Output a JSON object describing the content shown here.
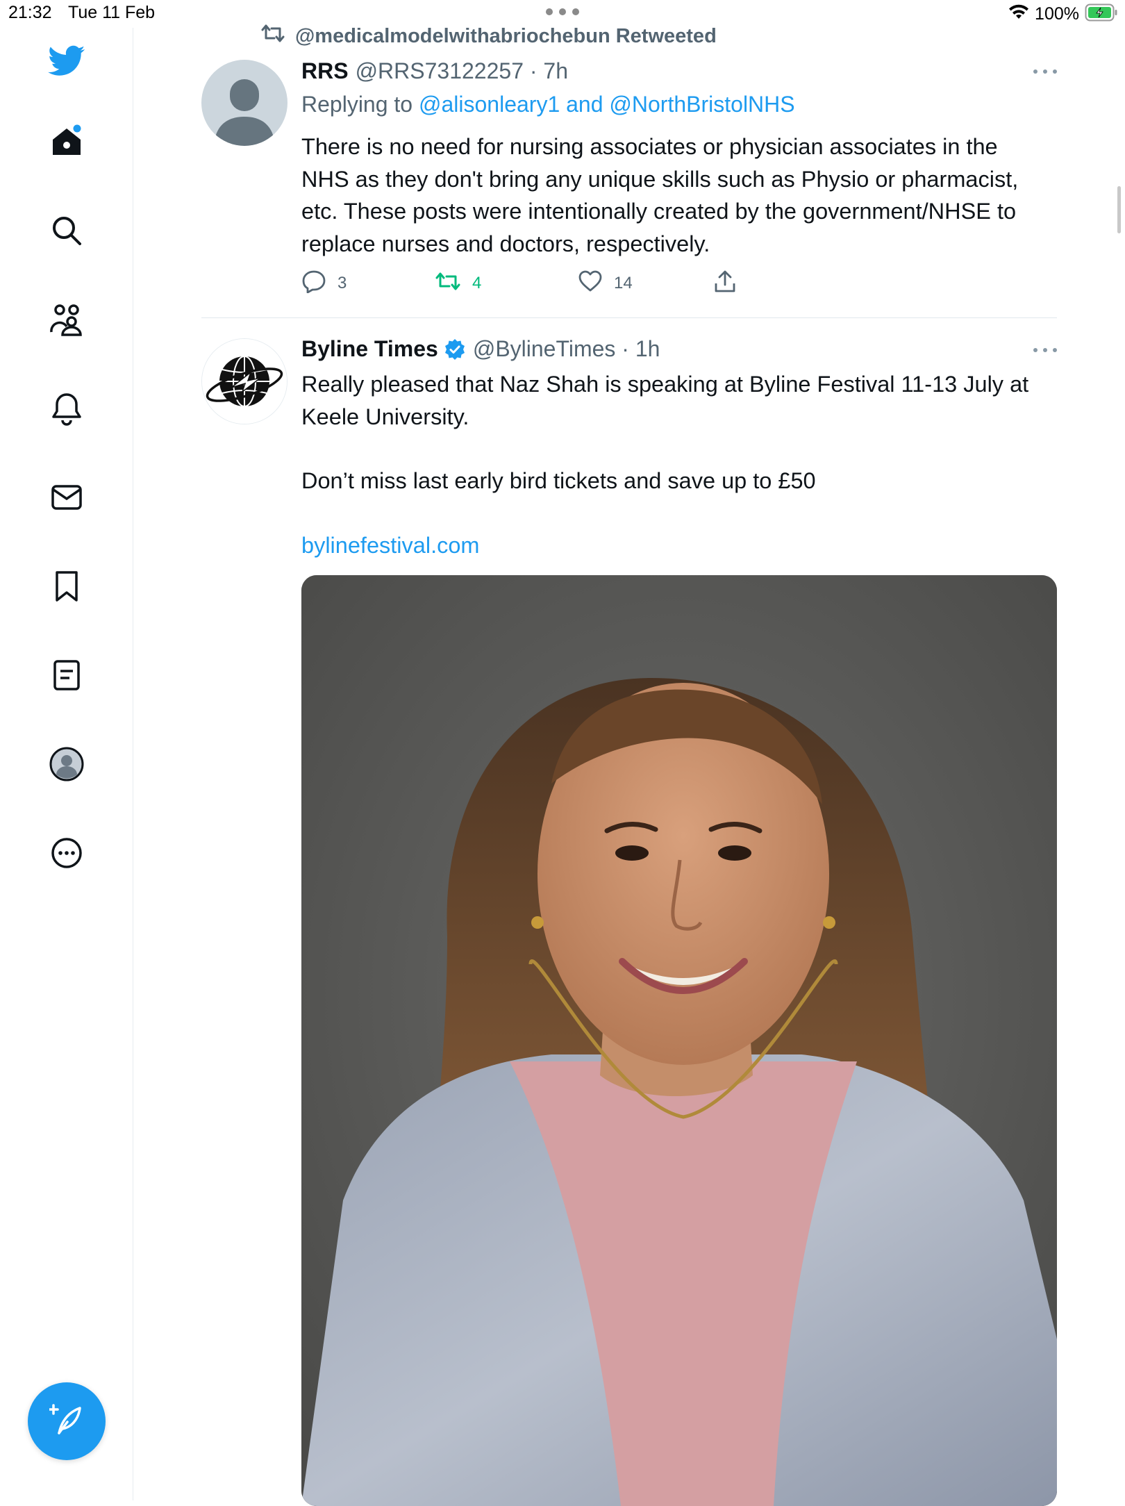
{
  "status_bar": {
    "time": "21:32",
    "date": "Tue 11 Feb",
    "battery": "100%"
  },
  "sidebar": {
    "items": [
      {
        "icon": "twitter-logo-icon"
      },
      {
        "icon": "home-icon"
      },
      {
        "icon": "search-icon"
      },
      {
        "icon": "communities-icon"
      },
      {
        "icon": "notifications-icon"
      },
      {
        "icon": "messages-icon"
      },
      {
        "icon": "bookmarks-icon"
      },
      {
        "icon": "lists-icon"
      },
      {
        "icon": "profile-icon"
      },
      {
        "icon": "more-icon"
      }
    ],
    "compose_icon": "compose-icon"
  },
  "colors": {
    "accent": "#1d9bf0",
    "retweet_green": "#00ba7c",
    "secondary_text": "#536471"
  },
  "timeline": {
    "tweets": [
      {
        "retweeted_by": "@medicalmodelwithabriochebun Retweeted",
        "name": "RRS",
        "handle": "@RRS73122257 · 7h",
        "reply_prefix": "Replying to",
        "reply_to": "@alisonleary1 and @NorthBristolNHS",
        "text": "There is no need for nursing associates or physician associates in the NHS as they don't bring any unique skills such as Physio or pharmacist, etc.  These posts were intentionally created by the government/NHSE to replace nurses and doctors, respectively.",
        "replies": "3",
        "retweets": "4",
        "likes": "14"
      },
      {
        "name": "Byline Times",
        "handle": "@BylineTimes · 1h",
        "verified": true,
        "text_line1": "Really pleased that Naz Shah is speaking at Byline Festival 11-13 July at Keele University.",
        "text_line2": "Don’t miss last early bird tickets and save up to £50",
        "link": "bylinefestival.com"
      }
    ]
  }
}
